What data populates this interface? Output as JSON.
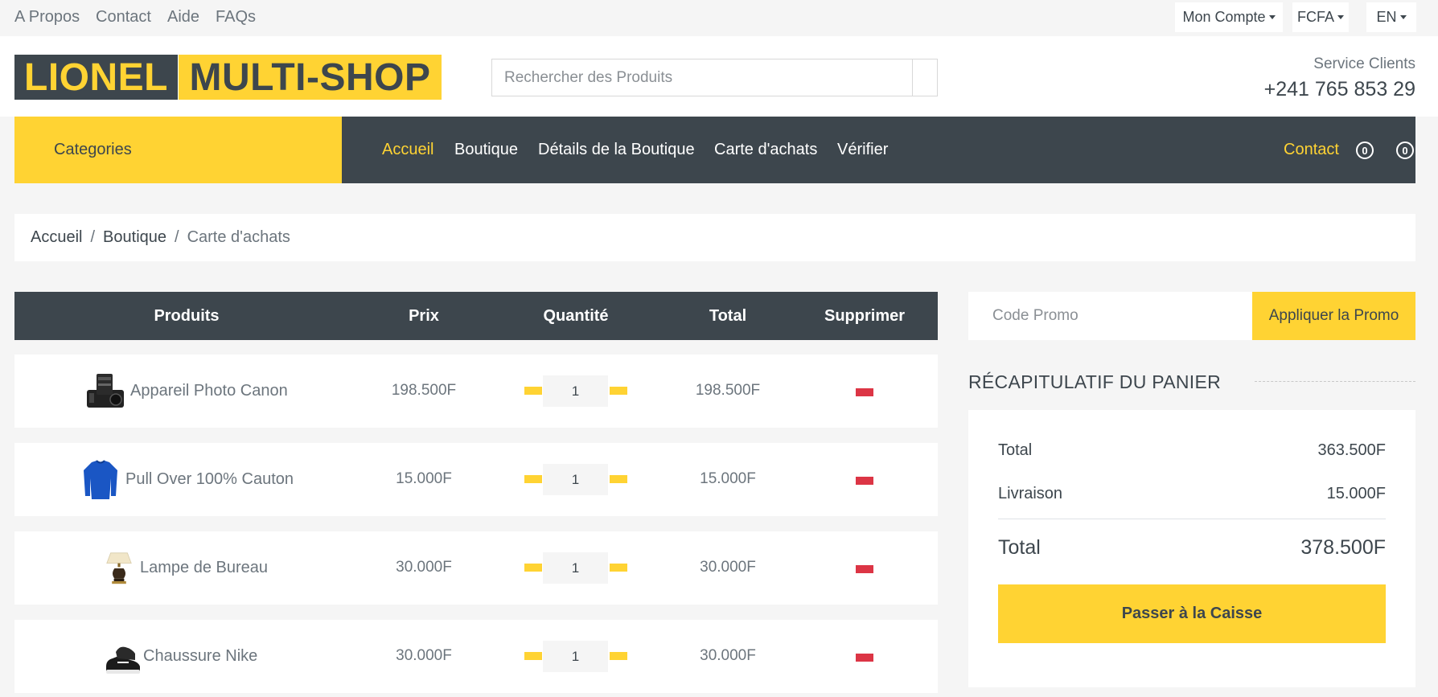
{
  "topbar": {
    "links": [
      "A Propos",
      "Contact",
      "Aide",
      "FAQs"
    ],
    "account": "Mon Compte",
    "currency": "FCFA",
    "language": "EN"
  },
  "header": {
    "logo_part1": "LIONEL",
    "logo_part2": "MULTI-SHOP",
    "search_placeholder": "Rechercher des Produits",
    "service_label": "Service Clients",
    "service_phone": "+241 765 853 29"
  },
  "nav": {
    "categories": "Categories",
    "links": [
      "Accueil",
      "Boutique",
      "Détails de la Boutique",
      "Carte d'achats",
      "Vérifier"
    ],
    "active_index": 0,
    "contact": "Contact",
    "wishlist_count": "0",
    "cart_count": "0"
  },
  "breadcrumb": [
    "Accueil",
    "Boutique",
    "Carte d'achats"
  ],
  "cart": {
    "headers": [
      "Produits",
      "Prix",
      "Quantité",
      "Total",
      "Supprimer"
    ],
    "rows": [
      {
        "name": "Appareil Photo Canon",
        "image": "camera-icon",
        "price": "198.500F",
        "qty": "1",
        "total": "198.500F"
      },
      {
        "name": "Pull Over 100% Cauton",
        "image": "sweater-icon",
        "price": "15.000F",
        "qty": "1",
        "total": "15.000F"
      },
      {
        "name": "Lampe de Bureau",
        "image": "lamp-icon",
        "price": "30.000F",
        "qty": "1",
        "total": "30.000F"
      },
      {
        "name": "Chaussure Nike",
        "image": "shoe-icon",
        "price": "30.000F",
        "qty": "1",
        "total": "30.000F"
      }
    ]
  },
  "promo": {
    "placeholder": "Code Promo",
    "button": "Appliquer la Promo"
  },
  "summary": {
    "title": "RÉCAPITULATIF DU PANIER",
    "subtotal_label": "Total",
    "subtotal": "363.500F",
    "shipping_label": "Livraison",
    "shipping": "15.000F",
    "total_label": "Total",
    "total": "378.500F",
    "checkout": "Passer à la Caisse"
  },
  "colors": {
    "primary": "#ffd333",
    "dark": "#3d464d",
    "danger": "#dc3545",
    "light": "#f5f5f5"
  }
}
